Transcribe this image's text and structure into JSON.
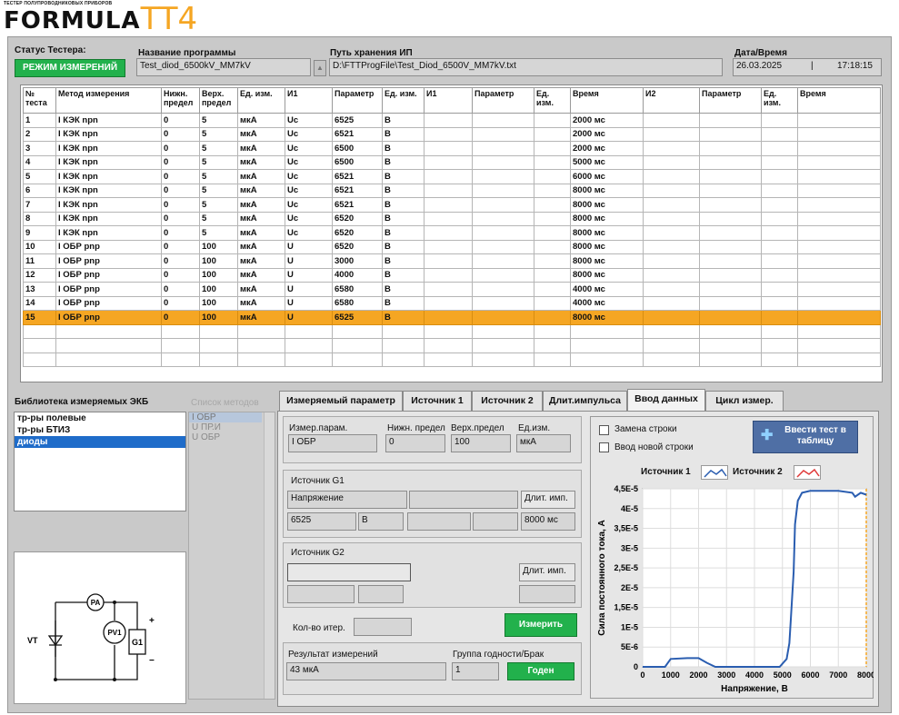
{
  "brand": {
    "tagline": "ТЕСТЕР ПОЛУПРОВОДНИКОВЫХ ПРИБОРОВ",
    "logo_text": "FORMULA",
    "logo_model": "TT4"
  },
  "colors": {
    "accent": "#f5a623",
    "status_green": "#22b14c",
    "chart_blue": "#2a5db0",
    "chart_red": "#e03a3a"
  },
  "header": {
    "status_label": "Статус Тестера:",
    "status_value": "РЕЖИМ ИЗМЕРЕНИЙ",
    "program_label": "Название программы",
    "program_value": "Test_diod_6500kV_MM7kV",
    "path_label": "Путь хранения ИП",
    "path_value": "D:\\FTTProgFile\\Test_Diod_6500V_MM7kV.txt",
    "datetime_label": "Дата/Время",
    "date": "26.03.2025",
    "separator": "|",
    "time": "17:18:15"
  },
  "table": {
    "columns": [
      "№ теста",
      "Метод измерения",
      "Нижн. предел",
      "Верх. предел",
      "Ед. изм.",
      "И1",
      "Параметр",
      "Ед. изм.",
      "И1",
      "Параметр",
      "Ед. изм.",
      "Время",
      "И2",
      "Параметр",
      "Ед. изм.",
      "Время"
    ],
    "rows": [
      [
        "1",
        "I КЭК npn",
        "0",
        "5",
        "мкА",
        "Uc",
        "6525",
        "В",
        "",
        "",
        "",
        "2000 мс",
        "",
        "",
        "",
        ""
      ],
      [
        "2",
        "I КЭК npn",
        "0",
        "5",
        "мкА",
        "Uc",
        "6521",
        "В",
        "",
        "",
        "",
        "2000 мс",
        "",
        "",
        "",
        ""
      ],
      [
        "3",
        "I КЭК npn",
        "0",
        "5",
        "мкА",
        "Uc",
        "6500",
        "В",
        "",
        "",
        "",
        "2000 мс",
        "",
        "",
        "",
        ""
      ],
      [
        "4",
        "I КЭК npn",
        "0",
        "5",
        "мкА",
        "Uc",
        "6500",
        "В",
        "",
        "",
        "",
        "5000 мс",
        "",
        "",
        "",
        ""
      ],
      [
        "5",
        "I КЭК npn",
        "0",
        "5",
        "мкА",
        "Uc",
        "6521",
        "В",
        "",
        "",
        "",
        "6000 мс",
        "",
        "",
        "",
        ""
      ],
      [
        "6",
        "I КЭК npn",
        "0",
        "5",
        "мкА",
        "Uc",
        "6521",
        "В",
        "",
        "",
        "",
        "8000 мс",
        "",
        "",
        "",
        ""
      ],
      [
        "7",
        "I КЭК npn",
        "0",
        "5",
        "мкА",
        "Uc",
        "6521",
        "В",
        "",
        "",
        "",
        "8000 мс",
        "",
        "",
        "",
        ""
      ],
      [
        "8",
        "I КЭК npn",
        "0",
        "5",
        "мкА",
        "Uc",
        "6520",
        "В",
        "",
        "",
        "",
        "8000 мс",
        "",
        "",
        "",
        ""
      ],
      [
        "9",
        "I КЭК npn",
        "0",
        "5",
        "мкА",
        "Uc",
        "6520",
        "В",
        "",
        "",
        "",
        "8000 мс",
        "",
        "",
        "",
        ""
      ],
      [
        "10",
        "I ОБР pnp",
        "0",
        "100",
        "мкА",
        "U",
        "6520",
        "В",
        "",
        "",
        "",
        "8000 мс",
        "",
        "",
        "",
        ""
      ],
      [
        "11",
        "I ОБР pnp",
        "0",
        "100",
        "мкА",
        "U",
        "3000",
        "В",
        "",
        "",
        "",
        "8000 мс",
        "",
        "",
        "",
        ""
      ],
      [
        "12",
        "I ОБР pnp",
        "0",
        "100",
        "мкА",
        "U",
        "4000",
        "В",
        "",
        "",
        "",
        "8000 мс",
        "",
        "",
        "",
        ""
      ],
      [
        "13",
        "I ОБР pnp",
        "0",
        "100",
        "мкА",
        "U",
        "6580",
        "В",
        "",
        "",
        "",
        "4000 мс",
        "",
        "",
        "",
        ""
      ],
      [
        "14",
        "I ОБР pnp",
        "0",
        "100",
        "мкА",
        "U",
        "6580",
        "В",
        "",
        "",
        "",
        "4000 мс",
        "",
        "",
        "",
        ""
      ],
      [
        "15",
        "I ОБР pnp",
        "0",
        "100",
        "мкА",
        "U",
        "6525",
        "В",
        "",
        "",
        "",
        "8000 мс",
        "",
        "",
        "",
        ""
      ]
    ],
    "selected_row": 15,
    "empty_rows": 3
  },
  "library": {
    "label": "Библиотека измеряемых ЭКБ",
    "items": [
      "тр-ры полевые",
      "тр-ры БТИЗ",
      "диоды"
    ],
    "selected": "диоды"
  },
  "methods": {
    "label": "Список методов",
    "items": [
      "I ОБР",
      "U ПР.И",
      "U ОБР"
    ]
  },
  "schematic": {
    "vt": "VT",
    "pa": "PA",
    "pv1": "PV1",
    "g1": "G1",
    "plus": "+",
    "minus": "−"
  },
  "tabs": [
    "Измеряемый параметр",
    "Источник 1",
    "Источник 2",
    "Длит.импульса",
    "Ввод данных",
    "Цикл измер."
  ],
  "active_tab": "Ввод данных",
  "param": {
    "name_label": "Измер.парам.",
    "name_value": "I ОБР",
    "low_label": "Нижн. предел",
    "low_value": "0",
    "high_label": "Верх.предел",
    "high_value": "100",
    "unit_label": "Ед.изм.",
    "unit_value": "мкА"
  },
  "source_g1": {
    "title": "Источник G1",
    "kind": "Напряжение",
    "pulse_label": "Длит. имп.",
    "value": "6525",
    "unit": "В",
    "pulse_value": "8000 мс"
  },
  "source_g2": {
    "title": "Источник G2",
    "pulse_label": "Длит. имп."
  },
  "iterations_label": "Кол-во итер.",
  "measure_button": "Измерить",
  "result": {
    "label": "Результат измерений",
    "value": "43 мкА",
    "group_label": "Группа годности/Брак",
    "group_value": "1",
    "verdict": "Годен"
  },
  "data_entry": {
    "replace_row": "Замена строки",
    "new_row": "Ввод новой строки",
    "enter_button": "Ввести тест в таблицу"
  },
  "chart_data": {
    "type": "line",
    "legend": [
      "Источник 1",
      "Источник 2"
    ],
    "xlabel": "Напряжение, В",
    "ylabel": "Сила постоянного тока, А",
    "xlim": [
      0,
      8000
    ],
    "ylim": [
      0,
      4.5e-05
    ],
    "x_ticks": [
      "0",
      "1000",
      "2000",
      "3000",
      "4000",
      "5000",
      "6000",
      "7000",
      "8000"
    ],
    "y_ticks": [
      "0",
      "5E-6",
      "1E-5",
      "1,5E-5",
      "2E-5",
      "2,5E-5",
      "3E-5",
      "3,5E-5",
      "4E-5",
      "4,5E-5"
    ],
    "grid": true,
    "series": [
      {
        "name": "Источник 1",
        "x": [
          0,
          800,
          1000,
          1600,
          2000,
          2300,
          2600,
          4900,
          5150,
          5250,
          5300,
          5400,
          5450,
          5550,
          5700,
          6000,
          6500,
          7000,
          7500,
          7600,
          7800,
          8000
        ],
        "y": [
          0,
          0,
          2e-06,
          2.2e-06,
          2.2e-06,
          1e-06,
          0,
          0,
          2e-06,
          6e-06,
          1.2e-05,
          2.4e-05,
          3.6e-05,
          4.2e-05,
          4.4e-05,
          4.45e-05,
          4.45e-05,
          4.45e-05,
          4.4e-05,
          4.3e-05,
          4.4e-05,
          4.35e-05
        ]
      }
    ],
    "marker_x": 8000
  }
}
